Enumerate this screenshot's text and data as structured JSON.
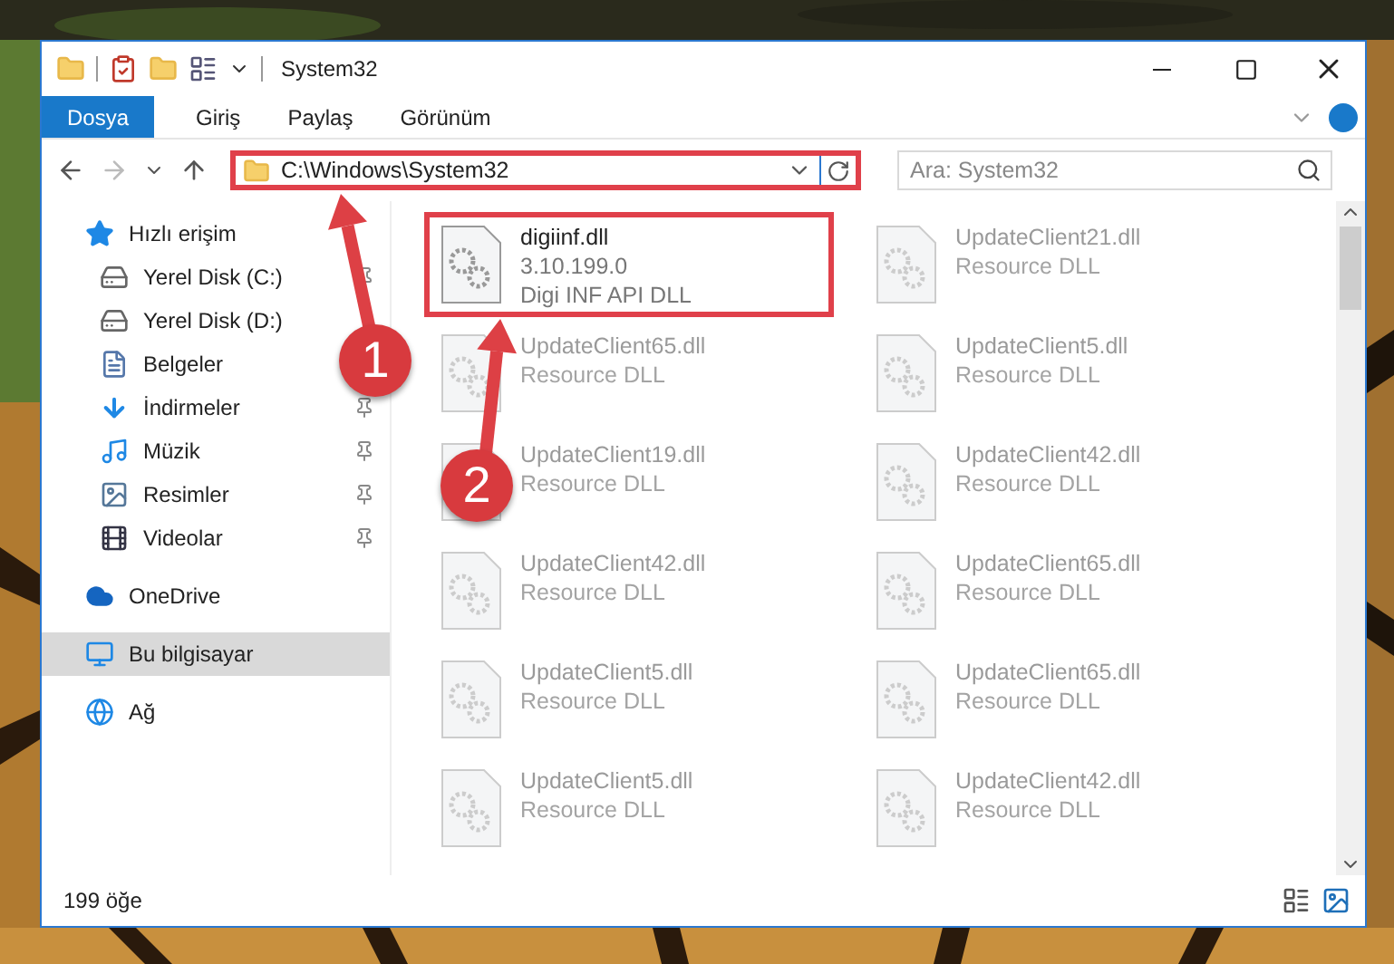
{
  "window": {
    "title": "System32"
  },
  "ribbon_tabs": [
    {
      "label": "Dosya",
      "kind": "file"
    },
    {
      "label": "Giriş",
      "kind": "tab"
    },
    {
      "label": "Paylaş",
      "kind": "tab"
    },
    {
      "label": "Görünüm",
      "kind": "tab"
    }
  ],
  "address_bar": {
    "path": "C:\\Windows\\System32",
    "highlighted": true
  },
  "search": {
    "placeholder": "Ara: System32"
  },
  "sidebar": {
    "items": [
      {
        "label": "Hızlı erişim",
        "kind": "quick-access",
        "selected": false,
        "pinned": false,
        "children": [
          {
            "label": "Yerel Disk (C:)",
            "kind": "system-drive",
            "selected": false,
            "pinned": true
          },
          {
            "label": "Yerel Disk (D:)",
            "kind": "drive",
            "selected": false,
            "pinned": false
          },
          {
            "label": "Belgeler",
            "kind": "documents",
            "selected": false,
            "pinned": false
          },
          {
            "label": "İndirmeler",
            "kind": "downloads",
            "selected": false,
            "pinned": true
          },
          {
            "label": "Müzik",
            "kind": "music",
            "selected": false,
            "pinned": true
          },
          {
            "label": "Resimler",
            "kind": "pictures",
            "selected": false,
            "pinned": true
          },
          {
            "label": "Videolar",
            "kind": "videos",
            "selected": false,
            "pinned": true
          }
        ]
      },
      {
        "label": "OneDrive",
        "kind": "cloud",
        "selected": false,
        "pinned": false
      },
      {
        "label": "Bu bilgisayar",
        "kind": "computer",
        "selected": true,
        "pinned": false
      },
      {
        "label": "Ağ",
        "kind": "network",
        "selected": false,
        "pinned": false
      }
    ]
  },
  "files": [
    {
      "name": "digiinf.dll",
      "details": [
        "3.10.199.0",
        "Digi INF API DLL"
      ],
      "highlighted": true,
      "blurred": false
    },
    {
      "name": "UpdateClient21.dll",
      "details": [
        "Resource DLL"
      ],
      "highlighted": false,
      "blurred": true
    },
    {
      "name": "UpdateClient65.dll",
      "details": [
        "Resource DLL"
      ],
      "highlighted": false,
      "blurred": true
    },
    {
      "name": "UpdateClient5.dll",
      "details": [
        "Resource DLL"
      ],
      "highlighted": false,
      "blurred": true
    },
    {
      "name": "UpdateClient19.dll",
      "details": [
        "Resource DLL"
      ],
      "highlighted": false,
      "blurred": true
    },
    {
      "name": "UpdateClient42.dll",
      "details": [
        "Resource DLL"
      ],
      "highlighted": false,
      "blurred": true
    },
    {
      "name": "UpdateClient42.dll",
      "details": [
        "Resource DLL"
      ],
      "highlighted": false,
      "blurred": true
    },
    {
      "name": "UpdateClient65.dll",
      "details": [
        "Resource DLL"
      ],
      "highlighted": false,
      "blurred": true
    },
    {
      "name": "UpdateClient5.dll",
      "details": [
        "Resource DLL"
      ],
      "highlighted": false,
      "blurred": true
    },
    {
      "name": "UpdateClient65.dll",
      "details": [
        "Resource DLL"
      ],
      "highlighted": false,
      "blurred": true
    },
    {
      "name": "UpdateClient5.dll",
      "details": [
        "Resource DLL"
      ],
      "highlighted": false,
      "blurred": true
    },
    {
      "name": "UpdateClient42.dll",
      "details": [
        "Resource DLL"
      ],
      "highlighted": false,
      "blurred": true
    }
  ],
  "status_bar": {
    "count": "199 öğe"
  },
  "callouts": [
    {
      "label": "1"
    },
    {
      "label": "2"
    }
  ]
}
